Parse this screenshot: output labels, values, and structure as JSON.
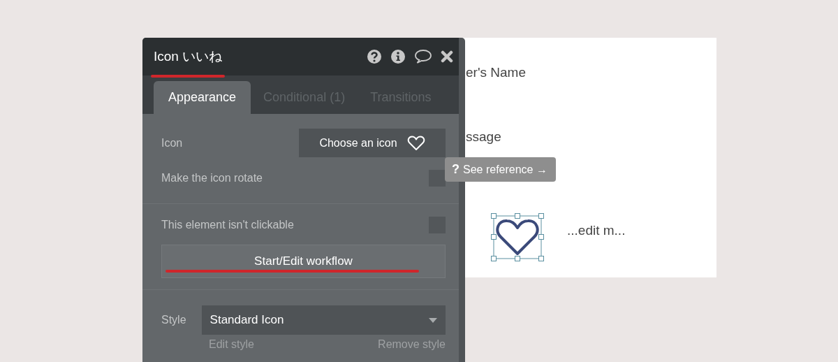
{
  "panel": {
    "title": "Icon いいね",
    "tabs": [
      {
        "label": "Appearance",
        "selected": true
      },
      {
        "label": "Conditional (1)",
        "selected": false
      },
      {
        "label": "Transitions",
        "selected": false
      }
    ],
    "sections": [
      [
        {
          "kind": "icon_picker",
          "label": "Icon",
          "value": "Choose an icon"
        },
        {
          "kind": "checkbox",
          "label": "Make the icon rotate",
          "checked": false
        }
      ],
      [
        {
          "kind": "checkbox",
          "label": "This element isn't clickable",
          "checked": false
        },
        {
          "kind": "button",
          "label": "Start/Edit workflow"
        }
      ],
      [
        {
          "kind": "select",
          "label": "Style",
          "value": "Standard Icon",
          "links": [
            "Edit style",
            "Remove style"
          ]
        }
      ]
    ]
  },
  "tooltip": {
    "icon": "?",
    "text": "See reference →"
  },
  "canvas": {
    "texts": [
      "er's Name",
      "ssage",
      "...edit m..."
    ]
  }
}
